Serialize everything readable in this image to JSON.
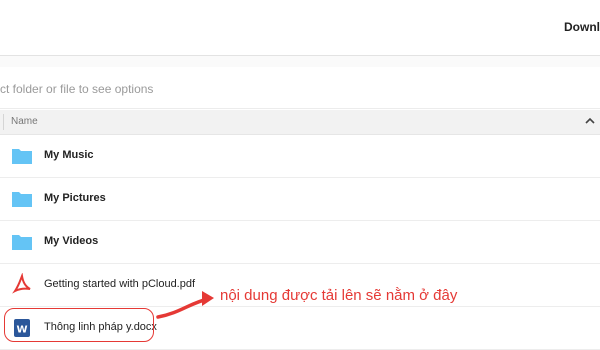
{
  "topbar": {
    "title_partial": "Downl"
  },
  "hint": {
    "text": "ct folder or file to see options"
  },
  "table": {
    "header_name": "Name",
    "rows": [
      {
        "label": "My Music",
        "icon": "folder-icon",
        "bold": true
      },
      {
        "label": "My Pictures",
        "icon": "folder-icon",
        "bold": true
      },
      {
        "label": "My Videos",
        "icon": "folder-icon",
        "bold": true
      },
      {
        "label": "Getting started with pCloud.pdf",
        "icon": "pdf-icon",
        "bold": false
      },
      {
        "label": "Thông linh pháp y.docx",
        "icon": "word-icon",
        "bold": false
      }
    ]
  },
  "annotation": {
    "text": "nội dung được tải lên sẽ nằm ở đây",
    "color": "#e53935"
  },
  "colors": {
    "folder": "#64c4f5",
    "pdf": "#e53935",
    "word": "#2b579a"
  }
}
